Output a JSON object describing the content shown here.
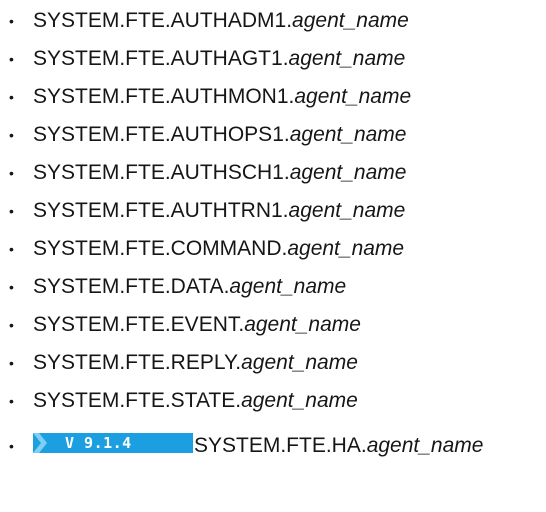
{
  "items": [
    {
      "prefix": "SYSTEM.FTE.AUTHADM1.",
      "suffix": "agent_name"
    },
    {
      "prefix": "SYSTEM.FTE.AUTHAGT1.",
      "suffix": "agent_name"
    },
    {
      "prefix": "SYSTEM.FTE.AUTHMON1.",
      "suffix": "agent_name"
    },
    {
      "prefix": "SYSTEM.FTE.AUTHOPS1.",
      "suffix": "agent_name"
    },
    {
      "prefix": "SYSTEM.FTE.AUTHSCH1.",
      "suffix": "agent_name"
    },
    {
      "prefix": "SYSTEM.FTE.AUTHTRN1.",
      "suffix": "agent_name"
    },
    {
      "prefix": "SYSTEM.FTE.COMMAND.",
      "suffix": "agent_name"
    },
    {
      "prefix": "SYSTEM.FTE.DATA.",
      "suffix": "agent_name"
    },
    {
      "prefix": "SYSTEM.FTE.EVENT.",
      "suffix": "agent_name"
    },
    {
      "prefix": "SYSTEM.FTE.REPLY.",
      "suffix": "agent_name"
    },
    {
      "prefix": "SYSTEM.FTE.STATE.",
      "suffix": "agent_name"
    },
    {
      "prefix": "SYSTEM.FTE.HA.",
      "suffix": "agent_name",
      "badge": "V 9.1.4"
    }
  ],
  "bullet": "•",
  "badge_color": "#1c9fe0"
}
